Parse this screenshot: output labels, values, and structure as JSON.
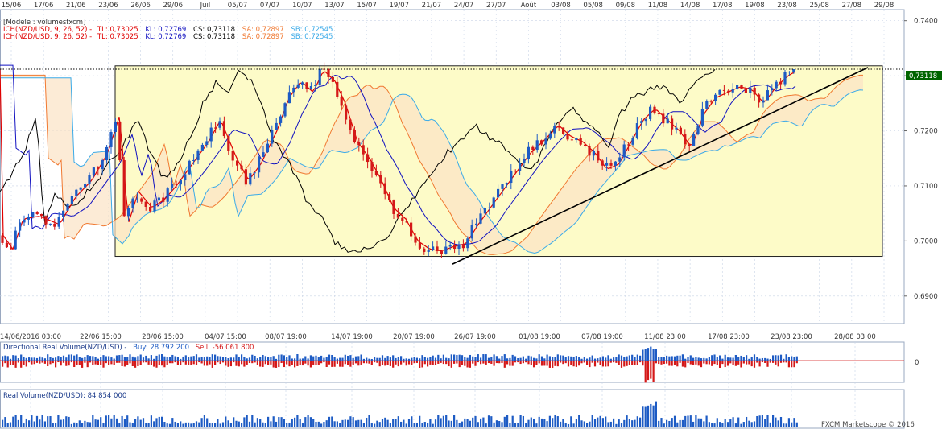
{
  "header": {
    "model_label": "[Modele : volumesfxcm]",
    "ich_prefix": "ICH(NZD/USD, 9, 26, 52)  -",
    "tl": "TL: 0,73025",
    "kl": "KL: 0,72769",
    "cs": "CS: 0,73118",
    "sa": "SA: 0,72897",
    "sb": "SB: 0,72545"
  },
  "colors": {
    "background": "#ffffff",
    "candle_up": "#1d5bc4",
    "candle_down": "#d41818",
    "tenkan": "#e00000",
    "kijun": "#1010c0",
    "chikou": "#000000",
    "span_a": "#f07830",
    "span_b": "#3aaae8",
    "cloud_bull": "#dff0ea",
    "cloud_bear": "#fbe3c4",
    "range_box": "#fdfbc8",
    "grid": "#c9d4e6",
    "price_tag": "#006400"
  },
  "footer": {
    "directional_title": "Directional Real Volume(NZD/USD) -",
    "buy": "Buy: 28 792 200",
    "sell": "Sell: -56 061 800",
    "real_volume": "Real Volume(NZD/USD): 84 854 000",
    "watermark": "FXCM Marketscope © 2016",
    "dir_zero": "0"
  },
  "chart_data": {
    "type": "candlestick",
    "instrument": "NZD/USD",
    "ichimoku_params": [
      9,
      26,
      52
    ],
    "top_date_labels": [
      "15/06",
      "17/06",
      "21/06",
      "23/06",
      "26/06",
      "29/06",
      "Juil",
      "05/07",
      "07/07",
      "10/07",
      "13/07",
      "15/07",
      "19/07",
      "21/07",
      "24/07",
      "27/07",
      "Août",
      "03/08",
      "05/08",
      "09/08",
      "11/08",
      "14/08",
      "17/08",
      "19/08",
      "23/08",
      "25/08",
      "27/08",
      "29/08"
    ],
    "bottom_time_labels": [
      "14/06/2016 03:00",
      "22/06 15:00",
      "28/06 15:00",
      "04/07 15:00",
      "08/07 19:00",
      "14/07 19:00",
      "20/07 19:00",
      "26/07 19:00",
      "01/08 19:00",
      "07/08 19:00",
      "11/08 23:00",
      "17/08 23:00",
      "23/08 23:00",
      "28/08 03:00"
    ],
    "y_axis_labels": [
      "0,7400",
      "0,7300",
      "0,7200",
      "0,7100",
      "0,7000",
      "0,6900"
    ],
    "ylim": [
      0.685,
      0.742
    ],
    "current_price_label": "0,73118",
    "current_price": 0.73118,
    "range_box": {
      "high": 0.7318,
      "low": 0.6972
    },
    "trendline": {
      "start": 0.6958,
      "end": 0.7315
    },
    "series": [
      {
        "name": "TL",
        "value": 0.73025
      },
      {
        "name": "KL",
        "value": 0.72769
      },
      {
        "name": "CS",
        "value": 0.73118
      },
      {
        "name": "SA",
        "value": 0.72897
      },
      {
        "name": "SB",
        "value": 0.72545
      }
    ]
  }
}
